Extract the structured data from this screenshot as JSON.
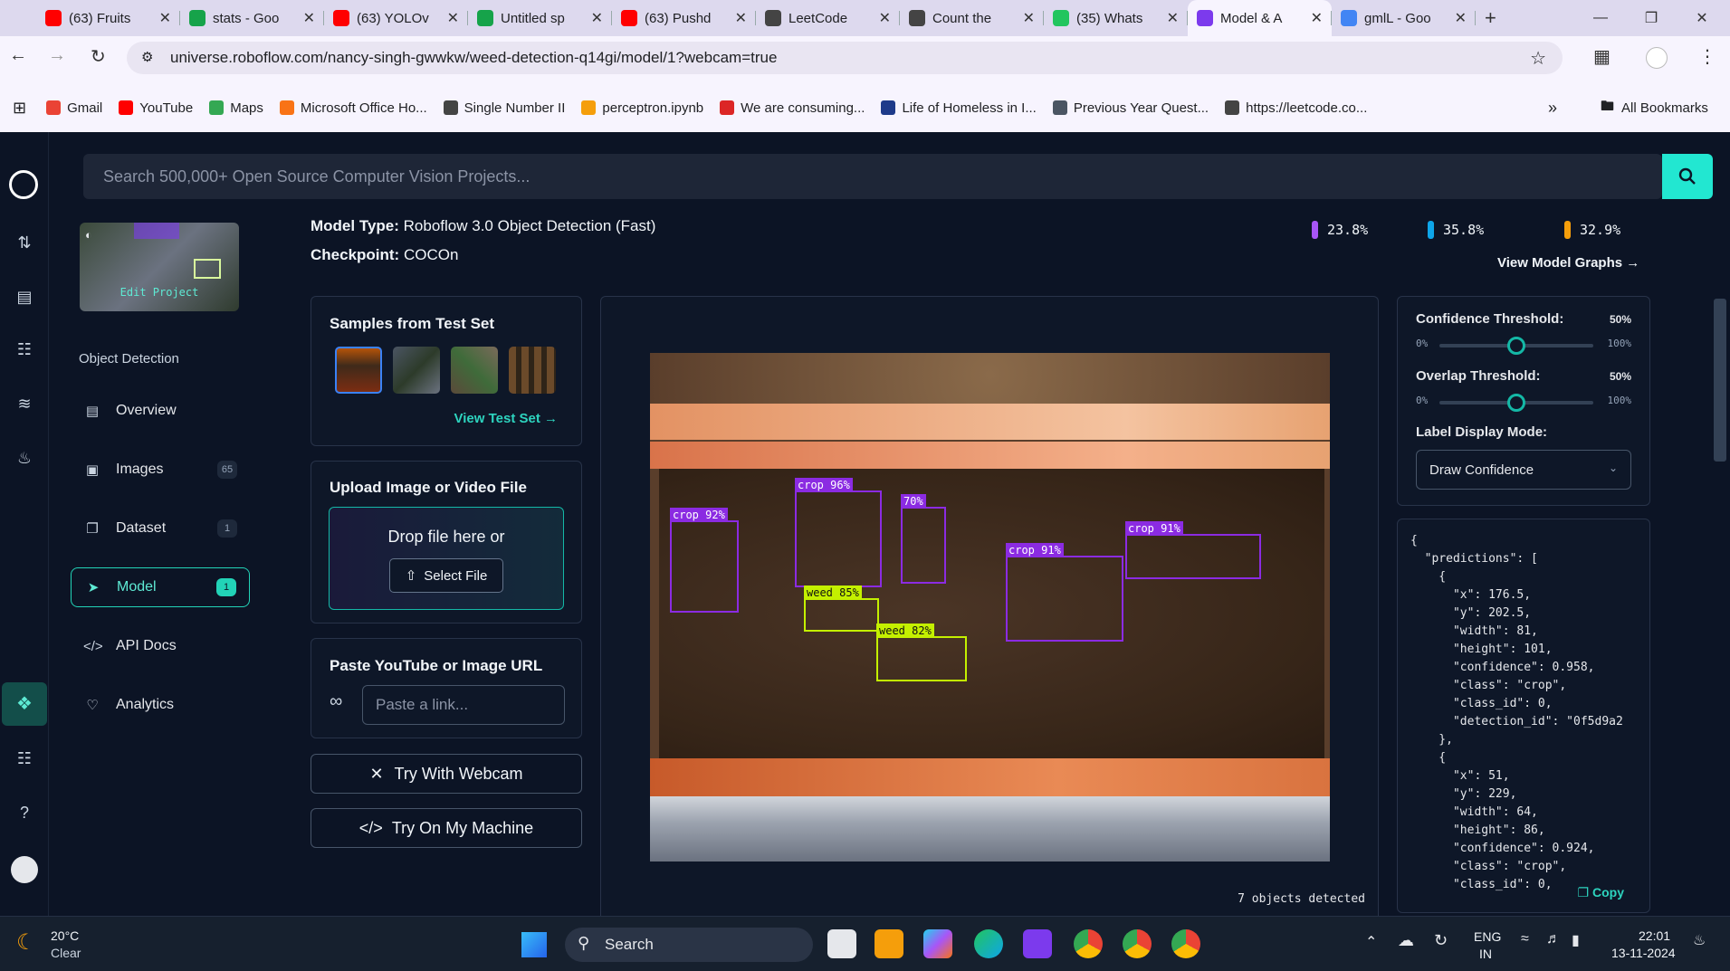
{
  "browser": {
    "tabs": [
      {
        "title": "(63) Fruits",
        "icon": "youtube-icon",
        "color": "#ff0000"
      },
      {
        "title": "stats - Goo",
        "icon": "sheets-icon",
        "color": "#16a34a"
      },
      {
        "title": "(63) YOLOv",
        "icon": "youtube-icon",
        "color": "#ff0000"
      },
      {
        "title": "Untitled sp",
        "icon": "sheets-icon",
        "color": "#16a34a"
      },
      {
        "title": "(63) Pushd",
        "icon": "youtube-icon",
        "color": "#ff0000"
      },
      {
        "title": "LeetCode",
        "icon": "leetcode-icon",
        "color": "#444444"
      },
      {
        "title": "Count the",
        "icon": "leetcode-icon",
        "color": "#444444"
      },
      {
        "title": "(35) Whats",
        "icon": "whatsapp-icon",
        "color": "#22c55e"
      },
      {
        "title": "Model & A",
        "icon": "roboflow-icon",
        "color": "#7c3aed"
      },
      {
        "title": "gmlL - Goo",
        "icon": "google-icon",
        "color": "#4285f4"
      }
    ],
    "url": "universe.roboflow.com/nancy-singh-gwwkw/weed-detection-q14gi/model/1?webcam=true",
    "bookmarks": [
      "Gmail",
      "YouTube",
      "Maps",
      "Microsoft Office Ho...",
      "Single Number II",
      "perceptron.ipynb",
      "We are consuming...",
      "Life of Homeless in I...",
      "Previous Year Quest...",
      "https://leetcode.co..."
    ],
    "all_bookmarks": "All Bookmarks"
  },
  "search": {
    "placeholder": "Search 500,000+ Open Source Computer Vision Projects..."
  },
  "sidebar": {
    "edit_project": "Edit Project",
    "section": "Object Detection",
    "items": [
      {
        "label": "Overview",
        "count": ""
      },
      {
        "label": "Images",
        "count": "65"
      },
      {
        "label": "Dataset",
        "count": "1"
      },
      {
        "label": "Model",
        "count": "1"
      },
      {
        "label": "API Docs",
        "count": ""
      },
      {
        "label": "Analytics",
        "count": ""
      }
    ]
  },
  "model": {
    "type_label": "Model Type:",
    "type_value": "Roboflow 3.0 Object Detection (Fast)",
    "checkpoint_label": "Checkpoint:",
    "checkpoint_value": "COCOn",
    "metrics": [
      {
        "value": "23.8%",
        "color": "#a855f7"
      },
      {
        "value": "35.8%",
        "color": "#0ea5e9"
      },
      {
        "value": "32.9%",
        "color": "#f59e0b"
      }
    ],
    "view_graphs": "View Model Graphs →"
  },
  "samples": {
    "title": "Samples from Test Set",
    "link": "View Test Set →"
  },
  "upload": {
    "title": "Upload Image or Video File",
    "drop": "Drop file here or",
    "select": "Select File"
  },
  "paste": {
    "title": "Paste YouTube or Image URL",
    "placeholder": "Paste a link..."
  },
  "webcam": "Try With Webcam",
  "machine": "Try On My Machine",
  "detections": [
    {
      "label": "crop 92%",
      "kind": "crop"
    },
    {
      "label": "crop 96%",
      "kind": "crop"
    },
    {
      "label": "70%",
      "kind": "crop"
    },
    {
      "label": "crop 91%",
      "kind": "crop"
    },
    {
      "label": "crop 91%",
      "kind": "crop"
    },
    {
      "label": "weed 85%",
      "kind": "weed"
    },
    {
      "label": "weed 82%",
      "kind": "weed"
    }
  ],
  "objects_detected": "7 objects detected",
  "controls": {
    "confidence_label": "Confidence Threshold:",
    "confidence_value": "50%",
    "overlap_label": "Overlap Threshold:",
    "overlap_value": "50%",
    "min": "0%",
    "max": "100%",
    "confidence_fraction": 0.5,
    "overlap_fraction": 0.5,
    "label_mode_label": "Label Display Mode:",
    "label_mode_value": "Draw Confidence"
  },
  "json_lines": [
    "{",
    "  \"predictions\": [",
    "    {",
    "      \"x\": 176.5,",
    "      \"y\": 202.5,",
    "      \"width\": 81,",
    "      \"height\": 101,",
    "      \"confidence\": 0.958,",
    "      \"class\": \"crop\",",
    "      \"class_id\": 0,",
    "      \"detection_id\": \"0f5d9a2",
    "    },",
    "    {",
    "      \"x\": 51,",
    "      \"y\": 229,",
    "      \"width\": 64,",
    "      \"height\": 86,",
    "      \"confidence\": 0.924,",
    "      \"class\": \"crop\",",
    "      \"class_id\": 0,"
  ],
  "copy": "Copy",
  "taskbar": {
    "temp": "20°C",
    "weather": "Clear",
    "search": "Search",
    "lang1": "ENG",
    "lang2": "IN",
    "time": "22:01",
    "date": "13-11-2024"
  }
}
